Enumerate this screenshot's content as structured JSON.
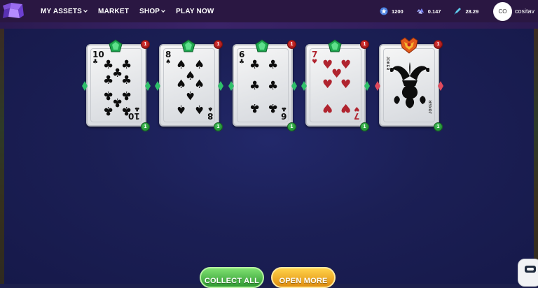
{
  "nav": {
    "links": [
      {
        "label": "MY ASSETS",
        "dropdown": true
      },
      {
        "label": "MARKET",
        "dropdown": false
      },
      {
        "label": "SHOP",
        "dropdown": true
      },
      {
        "label": "PLAY NOW",
        "dropdown": false
      }
    ],
    "stats": [
      {
        "icon": "star-coin-icon",
        "value": "1200"
      },
      {
        "icon": "crystal-icon",
        "value": "0.147"
      },
      {
        "icon": "rocket-token-icon",
        "value": "28.29"
      }
    ],
    "user": {
      "initials": "CO",
      "name": "cositav"
    }
  },
  "cards": [
    {
      "rank": "10",
      "suit": "♣",
      "color": "black",
      "count_top": "1",
      "count_bottom": "1"
    },
    {
      "rank": "8",
      "suit": "♠",
      "color": "black",
      "count_top": "1",
      "count_bottom": "1"
    },
    {
      "rank": "6",
      "suit": "♣",
      "color": "black",
      "count_top": "1",
      "count_bottom": "1"
    },
    {
      "rank": "7",
      "suit": "♥",
      "color": "red",
      "count_top": "1",
      "count_bottom": "1"
    },
    {
      "rank": "JOKER",
      "suit": "",
      "color": "black",
      "count_top": "1",
      "count_bottom": "1",
      "side_label_left": "JOKER",
      "side_label_right": "JOKER"
    }
  ],
  "buttons": {
    "collect": "COLLECT ALL",
    "open": "OPEN MORE"
  },
  "colors": {
    "nav_bg": "#2a1742",
    "board_bg": "#1c1f4c",
    "collect": "#3fa93c",
    "open": "#f0a21c",
    "gem": "#21b35a"
  }
}
